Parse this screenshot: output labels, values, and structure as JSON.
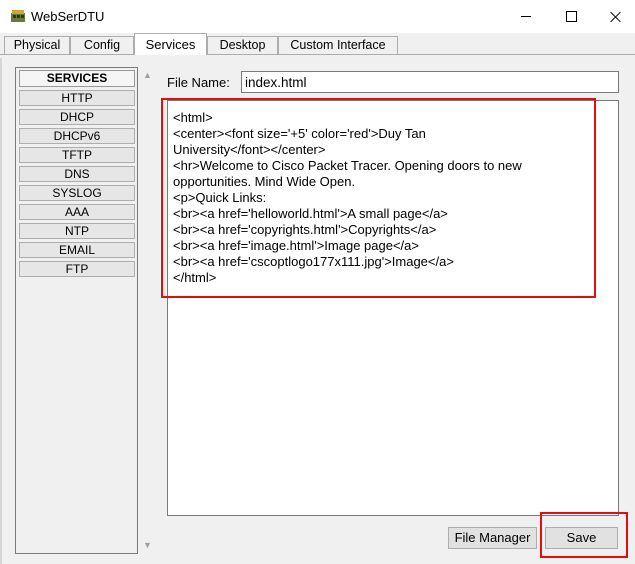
{
  "window": {
    "title": "WebSerDTU",
    "icon": "router-app-icon"
  },
  "tabs": [
    {
      "label": "Physical",
      "active": false
    },
    {
      "label": "Config",
      "active": false
    },
    {
      "label": "Services",
      "active": true
    },
    {
      "label": "Desktop",
      "active": false
    },
    {
      "label": "Custom Interface",
      "active": false
    }
  ],
  "services": {
    "header": "SERVICES",
    "items": [
      "HTTP",
      "DHCP",
      "DHCPv6",
      "TFTP",
      "DNS",
      "SYSLOG",
      "AAA",
      "NTP",
      "EMAIL",
      "FTP"
    ]
  },
  "file": {
    "name_label": "File Name:",
    "name_value": "index.html"
  },
  "editor": {
    "lines": [
      "<html>",
      "<center><font size='+5' color='red'>Duy Tan",
      "University</font></center>",
      "<hr>Welcome to Cisco Packet Tracer. Opening doors to new",
      "opportunities. Mind Wide Open.",
      "<p>Quick Links:",
      "<br><a href='helloworld.html'>A small page</a>",
      "<br><a href='copyrights.html'>Copyrights</a>",
      "<br><a href='image.html'>Image page</a>",
      "<br><a href='cscoptlogo177x111.jpg'>Image</a>",
      "</html>"
    ]
  },
  "buttons": {
    "file_manager": "File Manager",
    "save": "Save"
  },
  "colors": {
    "highlight": "#e01010",
    "panel_bg": "#f0f0f0"
  }
}
